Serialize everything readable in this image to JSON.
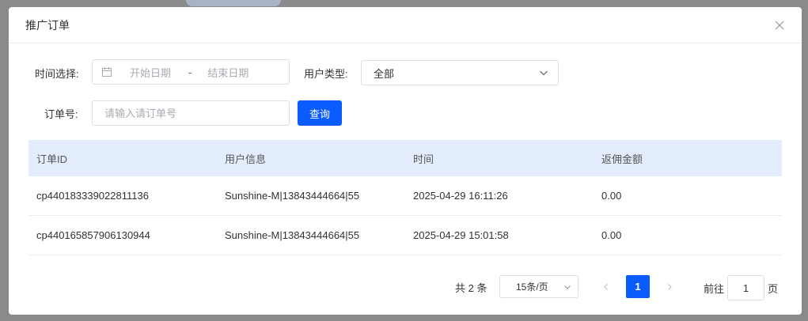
{
  "dialog": {
    "title": "推广订单"
  },
  "filters": {
    "time_label": "时间选择:",
    "start_placeholder": "开始日期",
    "range_sep": "-",
    "end_placeholder": "结束日期",
    "user_type_label": "用户类型:",
    "user_type_value": "全部",
    "order_label": "订单号:",
    "order_placeholder": "请输入请订单号",
    "search_label": "查询"
  },
  "table": {
    "headers": [
      "订单ID",
      "用户信息",
      "时间",
      "返佣金额"
    ],
    "rows": [
      [
        "cp440183339022811136",
        "Sunshine-M|13843444664|55",
        "2025-04-29 16:11:26",
        "0.00"
      ],
      [
        "cp440165857906130944",
        "Sunshine-M|13843444664|55",
        "2025-04-29 15:01:58",
        "0.00"
      ]
    ]
  },
  "pagination": {
    "total": "共 2 条",
    "page_size": "15条/页",
    "current_page": "1",
    "goto_label": "前往",
    "goto_value": "1",
    "page_unit": "页"
  },
  "colors": {
    "primary": "#0b5cff",
    "header_bg": "#e3edfd"
  },
  "icons": {
    "close": "close-icon",
    "calendar": "calendar-icon",
    "chevron": "chevron-down-icon"
  }
}
